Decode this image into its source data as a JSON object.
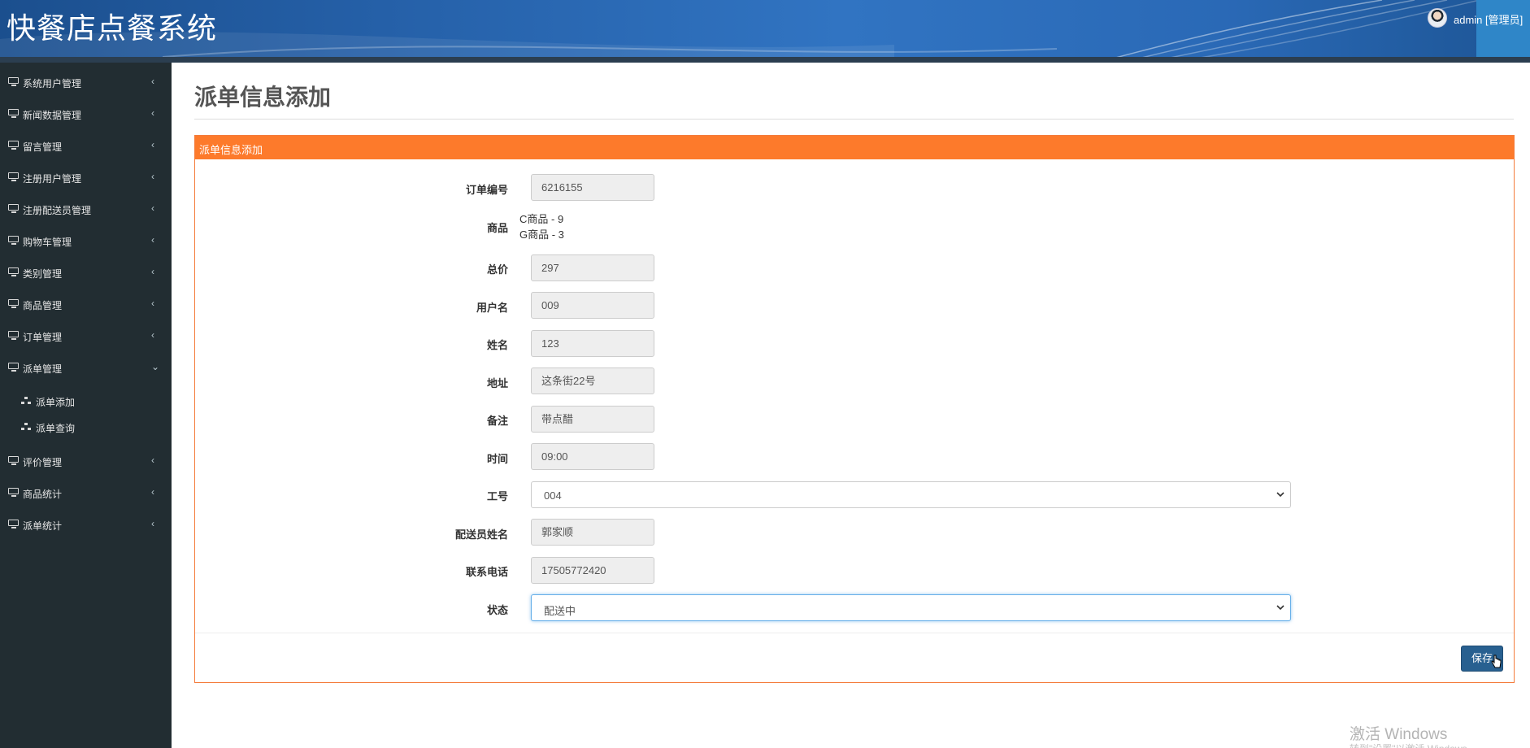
{
  "app": {
    "title": "快餐店点餐系统"
  },
  "user": {
    "name": "admin [管理员]"
  },
  "sidebar": {
    "items": [
      {
        "label": "系统用户管理",
        "caret": "‹"
      },
      {
        "label": "新闻数据管理",
        "caret": "‹"
      },
      {
        "label": "留言管理",
        "caret": "‹"
      },
      {
        "label": "注册用户管理",
        "caret": "‹"
      },
      {
        "label": "注册配送员管理",
        "caret": "‹"
      },
      {
        "label": "购物车管理",
        "caret": "‹"
      },
      {
        "label": "类别管理",
        "caret": "‹"
      },
      {
        "label": "商品管理",
        "caret": "‹"
      },
      {
        "label": "订单管理",
        "caret": "‹"
      },
      {
        "label": "派单管理",
        "caret": "⌄",
        "expanded": true
      },
      {
        "label": "评价管理",
        "caret": "‹"
      },
      {
        "label": "商品统计",
        "caret": "‹"
      },
      {
        "label": "派单统计",
        "caret": "‹"
      }
    ],
    "subitems": [
      {
        "label": "派单添加"
      },
      {
        "label": "派单查询"
      }
    ]
  },
  "page": {
    "title": "派单信息添加"
  },
  "panel": {
    "title": "派单信息添加"
  },
  "form": {
    "order_no": {
      "label": "订单编号",
      "value": "6216155"
    },
    "goods": {
      "label": "商品",
      "lines": [
        "C商品 - 9",
        "G商品 - 3"
      ]
    },
    "total": {
      "label": "总价",
      "value": "297"
    },
    "username": {
      "label": "用户名",
      "value": "009"
    },
    "name": {
      "label": "姓名",
      "value": "123"
    },
    "address": {
      "label": "地址",
      "value": "这条街22号"
    },
    "remark": {
      "label": "备注",
      "value": "带点醋"
    },
    "time": {
      "label": "时间",
      "value": "09:00"
    },
    "worker_id": {
      "label": "工号",
      "selected": "004"
    },
    "courier_name": {
      "label": "配送员姓名",
      "value": "郭家顺"
    },
    "phone": {
      "label": "联系电话",
      "value": "17505772420"
    },
    "status": {
      "label": "状态",
      "selected": "配送中"
    }
  },
  "actions": {
    "save_label": "保存"
  },
  "watermark": {
    "line1": "激活 Windows",
    "line2": "转到\"设置\"以激活 Windows。"
  },
  "colors": {
    "accent_orange": "#fd7a2b",
    "sidebar_bg": "#222d32",
    "primary_button": "#286090"
  },
  "icons": {
    "nav": "desktop-icon",
    "sub": "sitemap-icon"
  }
}
